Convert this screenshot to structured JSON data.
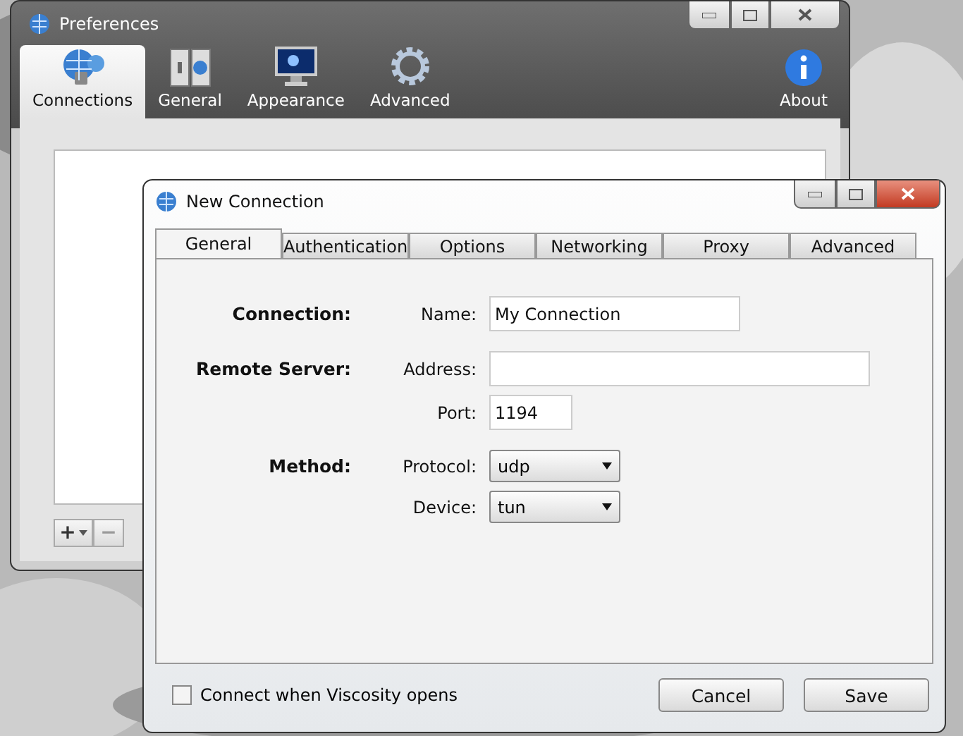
{
  "preferences_window": {
    "title": "Preferences",
    "toolbar": [
      {
        "label": "Connections",
        "selected": true
      },
      {
        "label": "General",
        "selected": false
      },
      {
        "label": "Appearance",
        "selected": false
      },
      {
        "label": "Advanced",
        "selected": false
      },
      {
        "label": "About",
        "selected": false
      }
    ],
    "list_buttons": [
      "+",
      "−"
    ]
  },
  "new_connection_window": {
    "title": "New Connection",
    "tabs": [
      {
        "label": "General",
        "selected": true
      },
      {
        "label": "Authentication",
        "selected": false
      },
      {
        "label": "Options",
        "selected": false
      },
      {
        "label": "Networking",
        "selected": false
      },
      {
        "label": "Proxy",
        "selected": false
      },
      {
        "label": "Advanced",
        "selected": false
      }
    ],
    "sections": [
      {
        "heading": "Connection:",
        "fields": [
          {
            "kind": "wide",
            "label": "Name:",
            "value": "My Connection"
          }
        ]
      },
      {
        "heading": "Remote Server:",
        "fields": [
          {
            "kind": "long",
            "label": "Address:"
          },
          {
            "kind": "short",
            "label": "Port:",
            "value": "1194"
          }
        ]
      },
      {
        "heading": "Method:",
        "fields": [
          {
            "kind": "select",
            "label": "Protocol:",
            "value": "udp"
          },
          {
            "kind": "select",
            "label": "Device:",
            "value": "tun"
          }
        ]
      }
    ],
    "checkbox": {
      "label": "Connect when Viscosity opens",
      "checked": false
    },
    "buttons": [
      "Cancel",
      "Save"
    ]
  }
}
